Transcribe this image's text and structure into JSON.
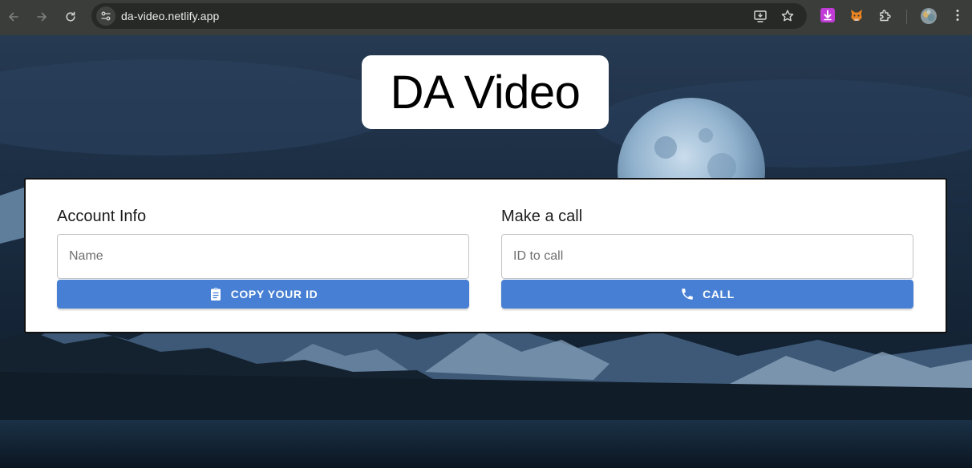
{
  "browser": {
    "url": "da-video.netlify.app",
    "icons": {
      "back": "back-arrow-icon",
      "forward": "forward-arrow-icon",
      "reload": "reload-icon",
      "site_info": "tune-icon",
      "cast": "install-app-icon",
      "bookmark": "star-icon",
      "ext1": "download-extension-icon",
      "ext2": "metamask-fox-icon",
      "ext3": "puzzle-icon",
      "profile": "profile-avatar",
      "menu": "kebab-menu-icon"
    }
  },
  "app": {
    "title": "DA Video"
  },
  "account": {
    "heading": "Account Info",
    "name_placeholder": "Name",
    "name_value": "",
    "copy_button": "Copy Your ID"
  },
  "call": {
    "heading": "Make a call",
    "id_placeholder": "ID to call",
    "id_value": "",
    "call_button": "Call"
  },
  "colors": {
    "accent": "#467fd3",
    "card_bg": "#ffffff",
    "chrome_bg": "#3a3d3a"
  }
}
